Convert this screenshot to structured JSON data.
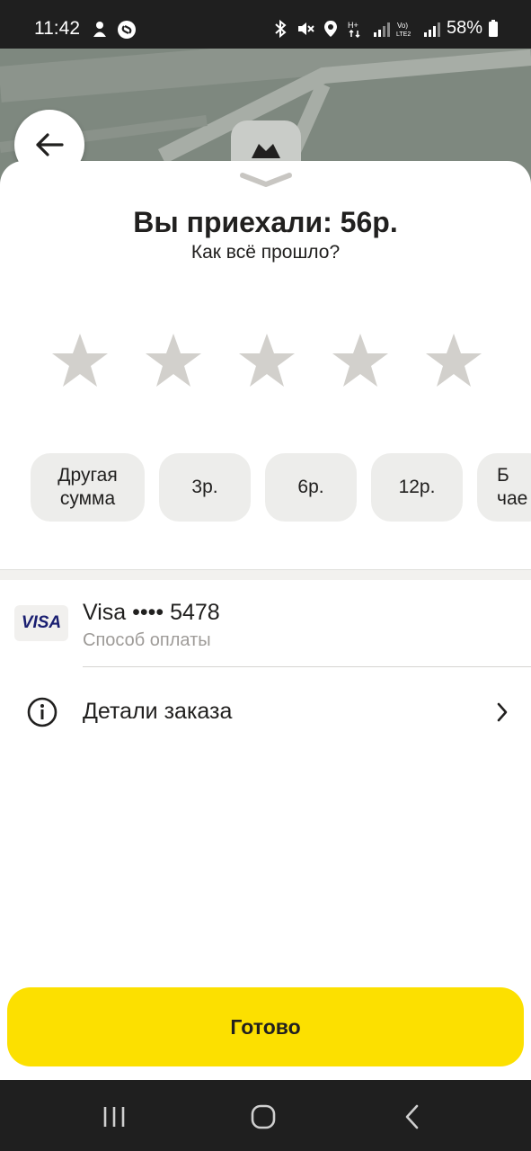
{
  "status_bar": {
    "time": "11:42",
    "battery": "58%",
    "icons": [
      "notification-icon",
      "shazam-icon",
      "bluetooth-icon",
      "mute-icon",
      "location-icon",
      "data-icon",
      "signal-icon",
      "volte-icon",
      "signal-icon",
      "battery-icon"
    ]
  },
  "map": {
    "back_icon": "arrow-left-icon",
    "marker_icon": "car-icon"
  },
  "trip": {
    "title": "Вы приехали: 56р.",
    "subtitle": "Как всё прошло?",
    "rating": {
      "max": 5,
      "value": 0
    }
  },
  "tips": [
    {
      "label": "Другая сумма"
    },
    {
      "label": "3р."
    },
    {
      "label": "6р."
    },
    {
      "label": "12р."
    },
    {
      "label": "Б\nчае"
    }
  ],
  "payment": {
    "card_brand": "VISA",
    "title": "Visa •••• 5478",
    "subtitle": "Способ оплаты"
  },
  "order_details": {
    "label": "Детали заказа"
  },
  "done_button": "Готово",
  "colors": {
    "accent": "#fce000",
    "star_inactive": "#d2d0cc",
    "chip_bg": "#ededeb"
  }
}
